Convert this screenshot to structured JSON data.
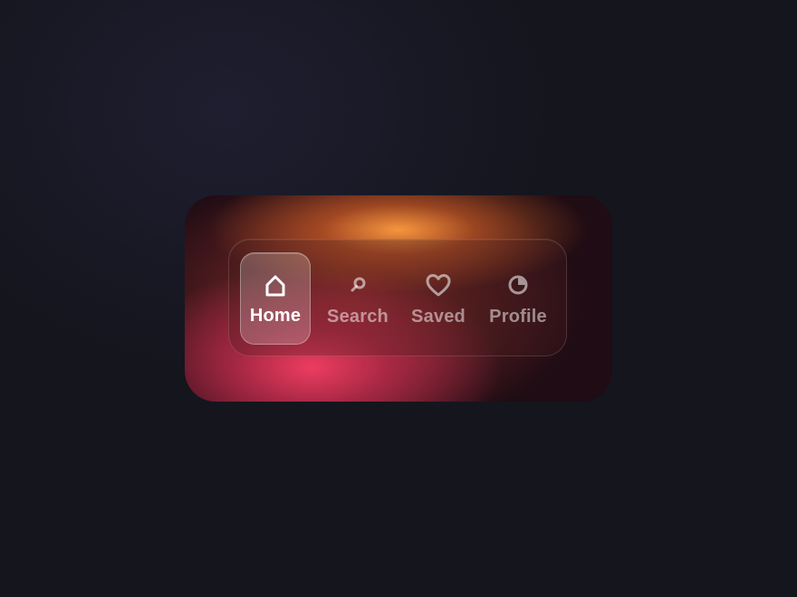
{
  "nav": {
    "items": [
      {
        "id": "home",
        "label": "Home",
        "icon": "home-icon",
        "active": true
      },
      {
        "id": "search",
        "label": "Search",
        "icon": "search-icon",
        "active": false
      },
      {
        "id": "saved",
        "label": "Saved",
        "icon": "heart-icon",
        "active": false
      },
      {
        "id": "profile",
        "label": "Profile",
        "icon": "pie-chart-icon",
        "active": false
      }
    ]
  },
  "colors": {
    "background": "#15151e",
    "card_base": "#1f0c14",
    "glow_orange": "#ff9c40",
    "glow_pink": "#ec3c60",
    "active_label": "#ffffff",
    "inactive_label": "#ffffff80"
  }
}
